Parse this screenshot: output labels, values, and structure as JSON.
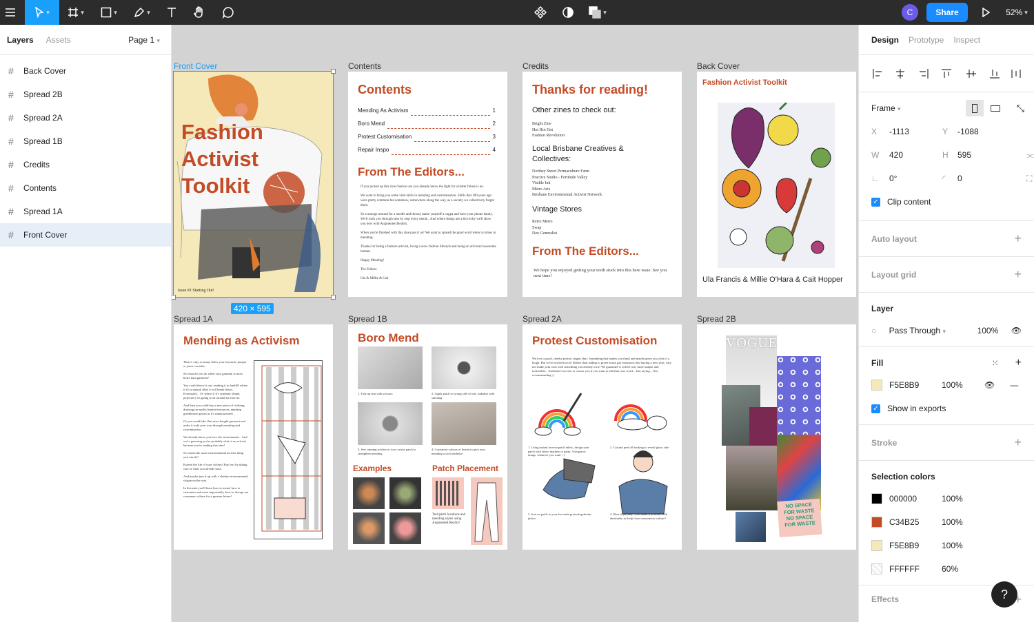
{
  "toolbar": {
    "share_label": "Share",
    "zoom": "52%",
    "avatar_initial": "C"
  },
  "left_panel": {
    "tab_layers": "Layers",
    "tab_assets": "Assets",
    "page": "Page 1",
    "layers": [
      "Back Cover",
      "Spread 2B",
      "Spread 2A",
      "Spread 1B",
      "Credits",
      "Contents",
      "Spread 1A",
      "Front Cover"
    ]
  },
  "canvas": {
    "selection_size": "420 × 595",
    "frames": {
      "front_cover": {
        "label": "Front Cover",
        "title": [
          "Fashion",
          "Activist",
          "Toolkit"
        ],
        "issue": "Issue #1 Starting Out!"
      },
      "contents": {
        "label": "Contents",
        "title": "Contents",
        "toc": [
          {
            "name": "Mending As Activism",
            "page": "1"
          },
          {
            "name": "Boro Mend",
            "page": "2"
          },
          {
            "name": "Protest Customisation",
            "page": "3"
          },
          {
            "name": "Repair Inspo",
            "page": "4"
          }
        ],
        "editors_title": "From The Editors...",
        "editors_text": [
          "If you picked up this zine chances are you already know the fight for a better future is on.",
          "We want to bring you some vital skills in mending and customisation. Skills that 100 years ago were pretty common but somehow, somewhere along the way, as a society we collectively forgot them.",
          "So scrounge around for a needle and thread, make yourself a cuppa and have your phone handy. We'll walk you through step by step every mend... And where things are a bit tricky we'll show you how with Augmented Reality.",
          "When you're finished with this zine pass it on! We want to spread the good word when it comes to mending.",
          "Thanks for being a fashion activist, living a slow fashion lifestyle and being an all round awesome human.",
          "Happy Mending!",
          "The Editors",
          "Ula & Millie & Cait"
        ]
      },
      "credits": {
        "label": "Credits",
        "title": "Thanks for reading!",
        "other_zines_title": "Other zines to check out:",
        "other_zines": [
          "Bright Zine",
          "Hot Hot Hot",
          "Fashion Revolution"
        ],
        "local_title": "Local Brisbane Creatives & Collectives:",
        "local": [
          "Northey Street Permaculture Farm",
          "Practice Studio - Fortitude Valley",
          "Visible Ink",
          "Metro Arts",
          "Brisbane Environmental Activist Network"
        ],
        "vintage_title": "Vintage Stores",
        "vintage": [
          "Retro Metro",
          "Swap",
          "Neo Generalist"
        ],
        "editors_title": "From The Editors...",
        "editors_text": "We hope you enjoyed getting your teeth stuck into this here issue. See you next time!"
      },
      "back_cover": {
        "label": "Back Cover",
        "title": "Fashion Activist Toolkit",
        "authors": "Ula Francis & Millie O'Hara & Cait Hopper"
      },
      "spread_1a": {
        "label": "Spread 1A",
        "title": "Mending as Activism",
        "paragraphs": [
          "There's only so many holes your favourite jumper or jeans can take.",
          "So what do you do when your garment is more holes than garment?",
          "You could throw it out, sending it to landfill where if it's a natural fibre it will break down... Eventually... Or where if it's synthetic (think polyester) it's going to sit around for forever.",
          "And then you could buy a new piece of clothing, drawing on earth's limited resources, emitting greenhouse gasses as it's manufactured.",
          "Or you could take that store bought garment and make it truly your own through mending and customisation.",
          "We already know you love the environment... And we're guessing you're probably a bit of an activist because you're reading this zine!",
          "So what's the most environmental activist thing you can do?",
          "Extend the life of your clothes! Buy less by taking care of what you already have.",
          "And maybe jazz it up with a cheeky environmental slogan on the way.",
          "In this zine you'll learn how to mend, how to customise and most importantly, how to disrupt our consumer culture for a greener future!"
        ]
      },
      "spread_1b": {
        "label": "Spread 1B",
        "title": "Boro Mend",
        "captions": [
          "1. Tidy up tear with scissors",
          "2. Apply patch to wrong side of tear, stabalise with stitching",
          "3. Sew running stitches in rows across patch to strengthen mending",
          "4. Customise colours of thread to give your mending a cool aesthetic!"
        ],
        "examples_title": "Examples",
        "patch_title": "Patch Placement",
        "patch_text": "Test patch locations and mending styles using Augmented Reality!"
      },
      "spread_2a": {
        "label": "Spread 2A",
        "title": "Protest Customisation",
        "intro": "We love a good, cheeky protest slogan shirt. Something that makes you think and maybe gives you a bit of a laugh. But we're not keen on it! Rather than adding to green house gas emissions buy buying a new shirt, why not make your own with something you already own? We guarantee it will be way more unique and noticeable... And there's no one to censor you if you want to add that cuss word... Just saying... Not recommending ;)",
        "captions": [
          "1. Using instant iron-on patch fabric, design your patch with fabric markers or paint. A slogan or image, whatever you want :-)",
          "2. Cut and peel off backing to reveal gluey side",
          "3. Iron on patch to your favourite protesting denim jacket",
          "4. Wear it proudly... you made it yourself with absolutely no help from consumerist culture!"
        ]
      },
      "spread_2b": {
        "label": "Spread 2B",
        "magazine": "VOGUE",
        "slogan": [
          "NO SPACE",
          "FOR WASTE",
          "NO SPACE",
          "FOR WASTE"
        ]
      }
    }
  },
  "right_panel": {
    "tab_design": "Design",
    "tab_prototype": "Prototype",
    "tab_inspect": "Inspect",
    "frame_label": "Frame",
    "x_label": "X",
    "x": "-1113",
    "y_label": "Y",
    "y": "-1088",
    "w_label": "W",
    "w": "420",
    "h_label": "H",
    "h": "595",
    "rotation": "0°",
    "radius": "0",
    "clip_content": "Clip content",
    "auto_layout": "Auto layout",
    "layout_grid": "Layout grid",
    "layer_title": "Layer",
    "blend": "Pass Through",
    "layer_opacity": "100%",
    "fill_title": "Fill",
    "fill_hex": "F5E8B9",
    "fill_opacity": "100%",
    "show_exports": "Show in exports",
    "stroke_title": "Stroke",
    "selection_colors_title": "Selection colors",
    "selection_colors": [
      {
        "hex": "000000",
        "opacity": "100%",
        "color": "#000000"
      },
      {
        "hex": "C34B25",
        "opacity": "100%",
        "color": "#C34B25"
      },
      {
        "hex": "F5E8B9",
        "opacity": "100%",
        "color": "#F5E8B9"
      },
      {
        "hex": "FFFFFF",
        "opacity": "60%",
        "color": "#FFFFFF"
      }
    ],
    "effects_title": "Effects",
    "help_label": "?"
  },
  "colors": {
    "accent": "#C34B25",
    "cover": "#F5E8B9",
    "figma_blue": "#18a0fb",
    "share_blue": "#1a8cff"
  }
}
